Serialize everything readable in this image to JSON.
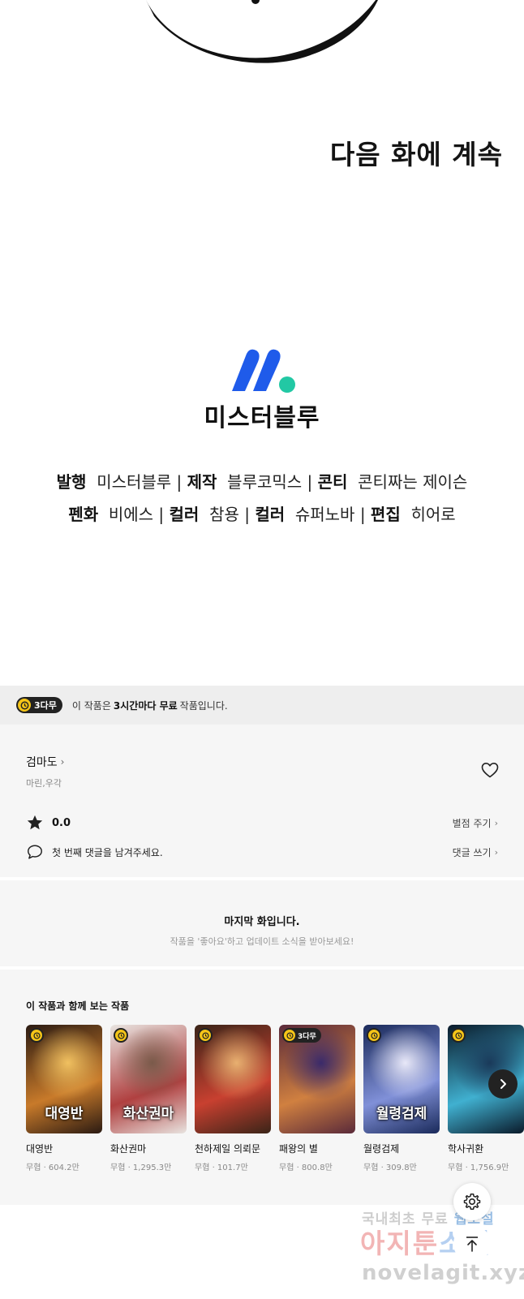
{
  "comic_end": {
    "continued_text": "다음 화에 계속",
    "publisher_name": "미스터블루",
    "credits_line1": [
      {
        "role": "발행",
        "name": "미스터블루"
      },
      {
        "role": "제작",
        "name": "블루코믹스"
      },
      {
        "role": "콘티",
        "name": "콘티짜는 제이슨"
      }
    ],
    "credits_line2": [
      {
        "role": "펜화",
        "name": "비에스"
      },
      {
        "role": "컬러",
        "name": "참용"
      },
      {
        "role": "컬러",
        "name": "슈퍼노바"
      },
      {
        "role": "편집",
        "name": "히어로"
      }
    ],
    "logo_colors": {
      "blue": "#1f5bea",
      "teal": "#22c8a4"
    }
  },
  "free_banner": {
    "badge": "3다무",
    "prefix": "이 작품은",
    "bold": "3시간마다 무료",
    "suffix": "작품입니다.",
    "badge_color": "#f5c518"
  },
  "work_info": {
    "title": "검마도",
    "authors": "마린,우각",
    "rating": "0.0",
    "rate_link": "별점 주기",
    "comment_prompt": "첫 번째 댓글을 남겨주세요.",
    "comment_link": "댓글 쓰기"
  },
  "last_episode": {
    "title": "마지막 화입니다.",
    "subtitle": "작품을 '좋아요'하고 업데이트 소식을 받아보세요!"
  },
  "recommendations": {
    "heading": "이 작품과 함께 보는 작품",
    "items": [
      {
        "name": "대영반",
        "meta": "무협 · 604.2만",
        "badge": "",
        "art_title": "대영반",
        "colors": [
          "#2a1a12",
          "#c87a2a",
          "#f0c060"
        ]
      },
      {
        "name": "화산권마",
        "meta": "무협 · 1,295.3만",
        "badge": "",
        "art_title": "화산권마",
        "colors": [
          "#e8e4e0",
          "#b04040",
          "#7a5a4a"
        ]
      },
      {
        "name": "천하제일 의뢰문",
        "meta": "무협 · 101.7만",
        "badge": "",
        "art_title": "",
        "colors": [
          "#3a2418",
          "#c84030",
          "#e8b070"
        ]
      },
      {
        "name": "패왕의 별",
        "meta": "무협 · 800.8만",
        "badge": "3다무",
        "art_title": "",
        "colors": [
          "#5a2a3a",
          "#d08040",
          "#3a2a6a"
        ]
      },
      {
        "name": "월령검제",
        "meta": "무협 · 309.8만",
        "badge": "",
        "art_title": "월령검제",
        "colors": [
          "#1a2a5a",
          "#8090d8",
          "#e8e8f8"
        ]
      },
      {
        "name": "학사귀환",
        "meta": "무협 · 1,756.9만",
        "badge": "",
        "art_title": "",
        "colors": [
          "#0a1a2a",
          "#40b0d0",
          "#1a3a5a"
        ]
      }
    ]
  },
  "icons": {
    "heart": "heart-icon",
    "star": "star-icon",
    "comment": "comment-icon",
    "next": "chevron-right-icon",
    "settings": "gear-icon",
    "scroll_top": "arrow-up-icon"
  },
  "watermark": {
    "line1_prefix": "국내최초 무료",
    "line1_accent": "웹소설",
    "line2_prefix": "아지툰",
    "line2_accent": "소설",
    "line3": "novelagit.xyz"
  }
}
